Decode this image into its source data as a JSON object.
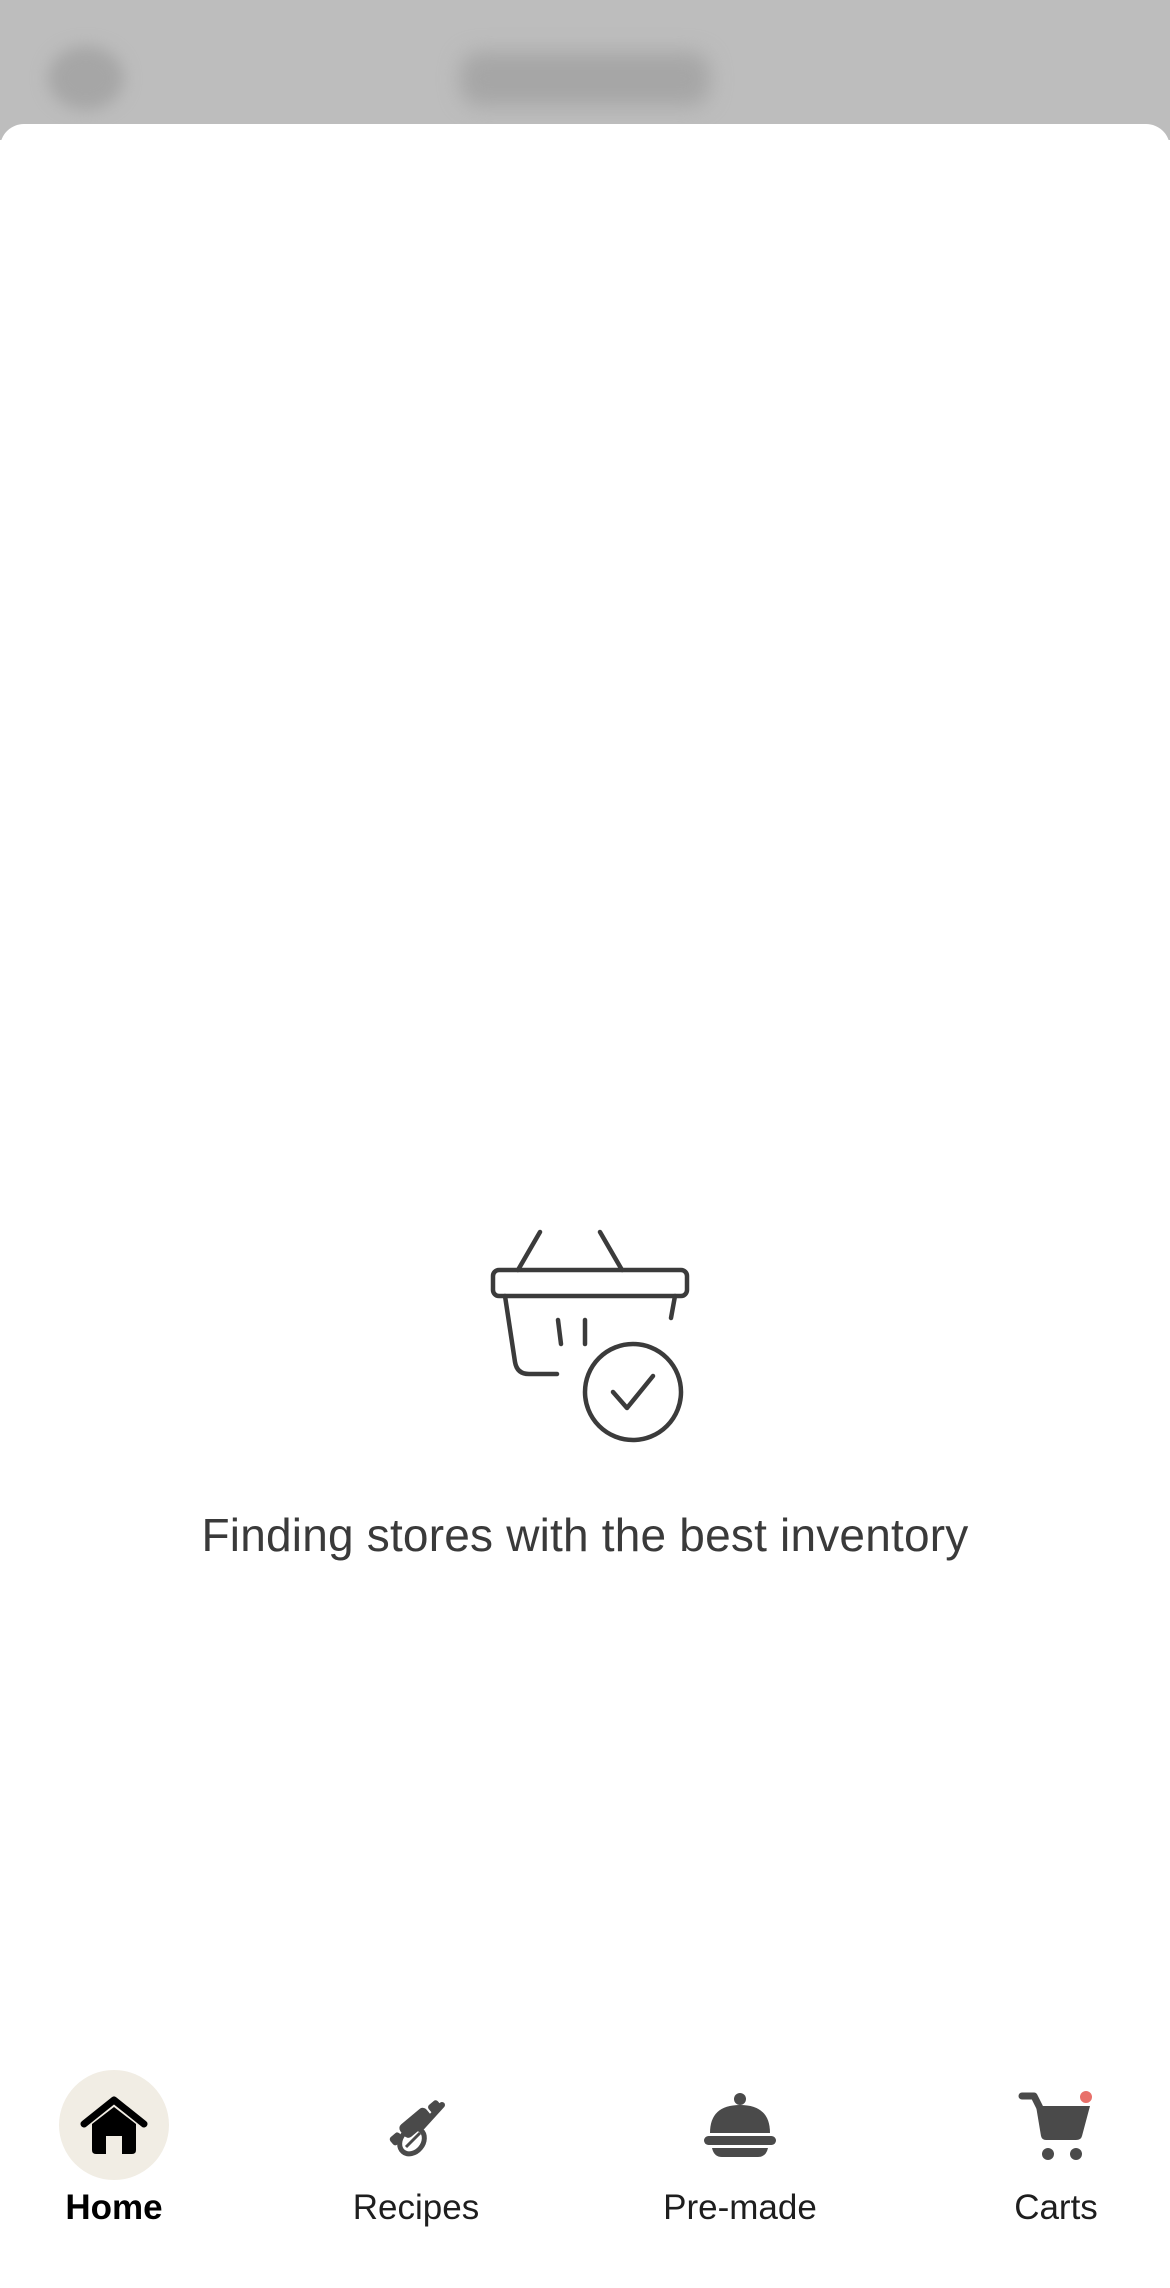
{
  "loading": {
    "message": "Finding stores with the best inventory",
    "illustration": "basket-check-icon"
  },
  "bottom_nav": {
    "items": [
      {
        "label": "Home",
        "icon": "home-icon",
        "active": true
      },
      {
        "label": "Recipes",
        "icon": "rolling-pin-whisk-icon",
        "active": false
      },
      {
        "label": "Pre-made",
        "icon": "cloche-icon",
        "active": false
      },
      {
        "label": "Carts",
        "icon": "cart-icon",
        "active": false,
        "has_notification_dot": true
      }
    ]
  },
  "colors": {
    "active_pill": "#f1ede4",
    "notification_dot": "#e8706a",
    "icon_gray": "#4a4a4a",
    "overlay": "#bdbdbd"
  }
}
